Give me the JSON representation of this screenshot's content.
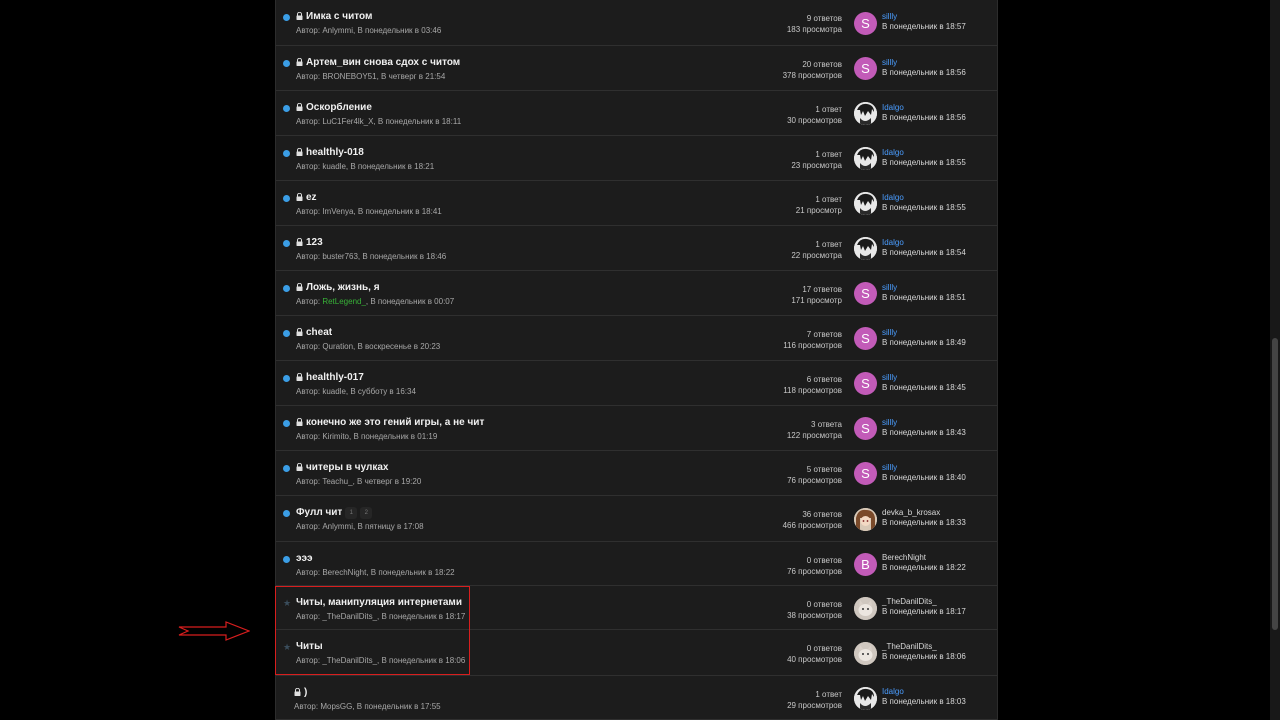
{
  "colors": {
    "unread_dot": "#3b9ee6",
    "highlight": "#d81e1e",
    "link_blue": "#4a9dff",
    "author_green": "#38b238",
    "avatar_pink": "#c25bb8"
  },
  "threads": [
    {
      "title": "Имка с читом",
      "locked": true,
      "marker": "dot",
      "author_prefix": "Автор: ",
      "author": "Anlymmi",
      "author_suffix": ", В понедельник в 03:46",
      "replies": "9 ответов",
      "views": "183 просмотра",
      "last_name": "sillly",
      "last_name_blue": true,
      "last_date": "В понедельник в 18:57",
      "avatar_letter": "S",
      "avatar_style": "av-s"
    },
    {
      "title": "Артем_вин снова сдох с читом",
      "locked": true,
      "marker": "dot",
      "author_prefix": "Автор: ",
      "author": "BRONEBOY51",
      "author_suffix": ", В четверг в 21:54",
      "replies": "20 ответов",
      "views": "378 просмотров",
      "last_name": "sillly",
      "last_name_blue": true,
      "last_date": "В понедельник в 18:56",
      "avatar_letter": "S",
      "avatar_style": "av-s"
    },
    {
      "title": "Оскорбление",
      "locked": true,
      "marker": "dot",
      "author_prefix": "Автор: ",
      "author": "LuC1Fer4lk_X",
      "author_suffix": ", В понедельник в 18:11",
      "replies": "1 ответ",
      "views": "30 просмотров",
      "last_name": "Idalgo",
      "last_name_blue": true,
      "last_date": "В понедельник в 18:56",
      "avatar_letter": "",
      "avatar_style": "av-img"
    },
    {
      "title": "healthly-018",
      "locked": true,
      "marker": "dot",
      "author_prefix": "Автор: ",
      "author": "kuadle",
      "author_suffix": ", В понедельник в 18:21",
      "replies": "1 ответ",
      "views": "23 просмотра",
      "last_name": "Idalgo",
      "last_name_blue": true,
      "last_date": "В понедельник в 18:55",
      "avatar_letter": "",
      "avatar_style": "av-img"
    },
    {
      "title": "ez",
      "locked": true,
      "marker": "dot",
      "author_prefix": "Автор: ",
      "author": "ImVenya",
      "author_suffix": ", В понедельник в 18:41",
      "replies": "1 ответ",
      "views": "21 просмотр",
      "last_name": "Idalgo",
      "last_name_blue": true,
      "last_date": "В понедельник в 18:55",
      "avatar_letter": "",
      "avatar_style": "av-img"
    },
    {
      "title": "123",
      "locked": true,
      "marker": "dot",
      "author_prefix": "Автор: ",
      "author": "buster763",
      "author_suffix": ", В понедельник в 18:46",
      "replies": "1 ответ",
      "views": "22 просмотра",
      "last_name": "Idalgo",
      "last_name_blue": true,
      "last_date": "В понедельник в 18:54",
      "avatar_letter": "",
      "avatar_style": "av-img"
    },
    {
      "title": "Ложь, жизнь, я",
      "locked": true,
      "marker": "dot",
      "author_prefix": "Автор: ",
      "author": "RetLegend_",
      "author_suffix": ", В понедельник в 00:07",
      "author_green": true,
      "replies": "17 ответов",
      "views": "171 просмотр",
      "last_name": "sillly",
      "last_name_blue": true,
      "last_date": "В понедельник в 18:51",
      "avatar_letter": "S",
      "avatar_style": "av-s"
    },
    {
      "title": "cheat",
      "locked": true,
      "marker": "dot",
      "author_prefix": "Автор: ",
      "author": "Quration",
      "author_suffix": ", В воскресенье в 20:23",
      "replies": "7 ответов",
      "views": "116 просмотров",
      "last_name": "sillly",
      "last_name_blue": true,
      "last_date": "В понедельник в 18:49",
      "avatar_letter": "S",
      "avatar_style": "av-s"
    },
    {
      "title": "healthly-017",
      "locked": true,
      "marker": "dot",
      "author_prefix": "Автор: ",
      "author": "kuadle",
      "author_suffix": ", В субботу в 16:34",
      "replies": "6 ответов",
      "views": "118 просмотров",
      "last_name": "sillly",
      "last_name_blue": true,
      "last_date": "В понедельник в 18:45",
      "avatar_letter": "S",
      "avatar_style": "av-s"
    },
    {
      "title": "конечно же это гений игры, а не чит",
      "locked": true,
      "marker": "dot",
      "author_prefix": "Автор: ",
      "author": "Kirimito",
      "author_suffix": ", В понедельник в 01:19",
      "replies": "3 ответа",
      "views": "122 просмотра",
      "last_name": "sillly",
      "last_name_blue": true,
      "last_date": "В понедельник в 18:43",
      "avatar_letter": "S",
      "avatar_style": "av-s"
    },
    {
      "title": "читеры в чулках",
      "locked": true,
      "marker": "dot",
      "author_prefix": "Автор: ",
      "author": "Teachu_",
      "author_suffix": ", В четверг в 19:20",
      "replies": "5 ответов",
      "views": "76 просмотров",
      "last_name": "sillly",
      "last_name_blue": true,
      "last_date": "В понедельник в 18:40",
      "avatar_letter": "S",
      "avatar_style": "av-s"
    },
    {
      "title": "Фулл чит",
      "locked": false,
      "marker": "dot",
      "pages": [
        "1",
        "2"
      ],
      "author_prefix": "Автор: ",
      "author": "Anlymmi",
      "author_suffix": ", В пятницу в 17:08",
      "replies": "36 ответов",
      "views": "466 просмотров",
      "last_name": "devka_b_krosax",
      "last_name_blue": false,
      "last_date": "В понедельник в 18:33",
      "avatar_letter": "",
      "avatar_style": "av-anime"
    },
    {
      "title": "эээ",
      "locked": false,
      "marker": "dot",
      "author_prefix": "Автор: ",
      "author": "BerechNight",
      "author_suffix": ", В понедельник в 18:22",
      "replies": "0 ответов",
      "views": "76 просмотров",
      "last_name": "BerechNight",
      "last_name_blue": false,
      "last_date": "В понедельник в 18:22",
      "avatar_letter": "B",
      "avatar_style": "av-b"
    },
    {
      "title": "Читы, манипуляция интернетами",
      "locked": false,
      "marker": "star",
      "author_prefix": "Автор: ",
      "author": "_TheDanilDits_",
      "author_suffix": ", В понедельник в 18:17",
      "replies": "0 ответов",
      "views": "38 просмотров",
      "last_name": "_TheDanilDits_",
      "last_name_blue": false,
      "last_date": "В понедельник в 18:17",
      "avatar_letter": "",
      "avatar_style": "av-cat"
    },
    {
      "title": "Читы",
      "locked": false,
      "marker": "star",
      "author_prefix": "Автор: ",
      "author": "_TheDanilDits_",
      "author_suffix": ", В понедельник в 18:06",
      "replies": "0 ответов",
      "views": "40 просмотров",
      "last_name": "_TheDanilDits_",
      "last_name_blue": false,
      "last_date": "В понедельник в 18:06",
      "avatar_letter": "",
      "avatar_style": "av-cat"
    },
    {
      "title": ")",
      "locked": true,
      "marker": "none",
      "author_prefix": "Автор: ",
      "author": "MopsGG",
      "author_suffix": ", В понедельник в 17:55",
      "replies": "1 ответ",
      "views": "29 просмотров",
      "last_name": "Idalgo",
      "last_name_blue": true,
      "last_date": "В понедельник в 18:03",
      "avatar_letter": "",
      "avatar_style": "av-img"
    }
  ]
}
